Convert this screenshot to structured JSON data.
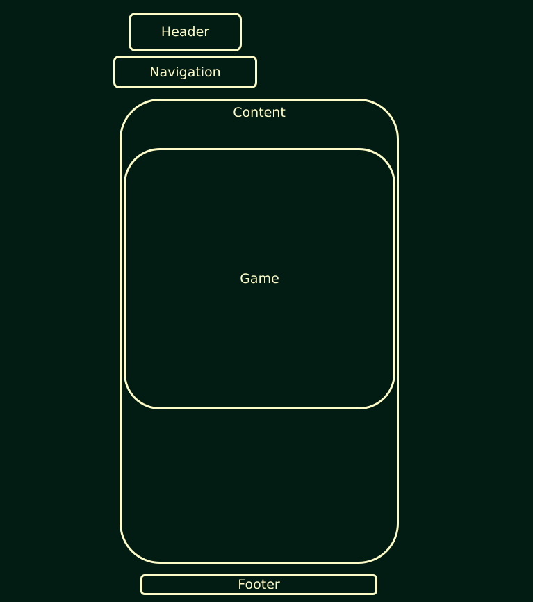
{
  "diagram": {
    "header": {
      "label": "Header"
    },
    "navigation": {
      "label": "Navigation"
    },
    "content": {
      "label": "Content"
    },
    "game": {
      "label": "Game"
    },
    "footer": {
      "label": "Footer"
    }
  },
  "colors": {
    "background": "#021c13",
    "stroke": "#fdfcc8",
    "text": "#fdfcc8"
  }
}
